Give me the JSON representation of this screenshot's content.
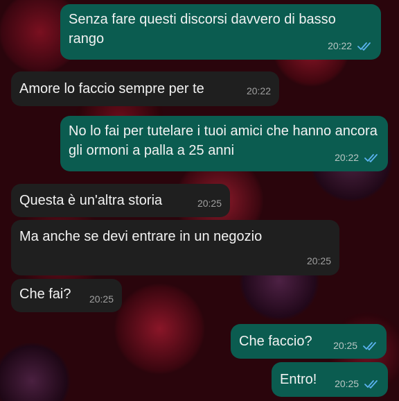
{
  "chat": {
    "messages": [
      {
        "direction": "out",
        "text": "Senza fare questi discorsi davvero di basso rango",
        "time": "20:22",
        "read": true
      },
      {
        "direction": "in",
        "text": "Amore lo faccio sempre per te",
        "time": "20:22"
      },
      {
        "direction": "out",
        "text": "No lo fai per tutelare i tuoi amici che hanno ancora gli ormoni a palla a 25 anni",
        "time": "20:22",
        "read": true
      },
      {
        "direction": "in",
        "text": "Questa è un'altra storia",
        "time": "20:25"
      },
      {
        "direction": "in",
        "text": "Ma anche se devi entrare in un negozio",
        "time": "20:25"
      },
      {
        "direction": "in",
        "text": "Che fai?",
        "time": "20:25"
      },
      {
        "direction": "out",
        "text": "Che faccio?",
        "time": "20:25",
        "read": true
      },
      {
        "direction": "out",
        "text": "Entro!",
        "time": "20:25",
        "read": true
      }
    ]
  },
  "colors": {
    "outgoing_bubble": "#0b5c50",
    "incoming_bubble": "#1f1f1f",
    "read_ticks": "#5bb3f0"
  },
  "icons": {
    "read_receipt": "double-check-icon"
  }
}
